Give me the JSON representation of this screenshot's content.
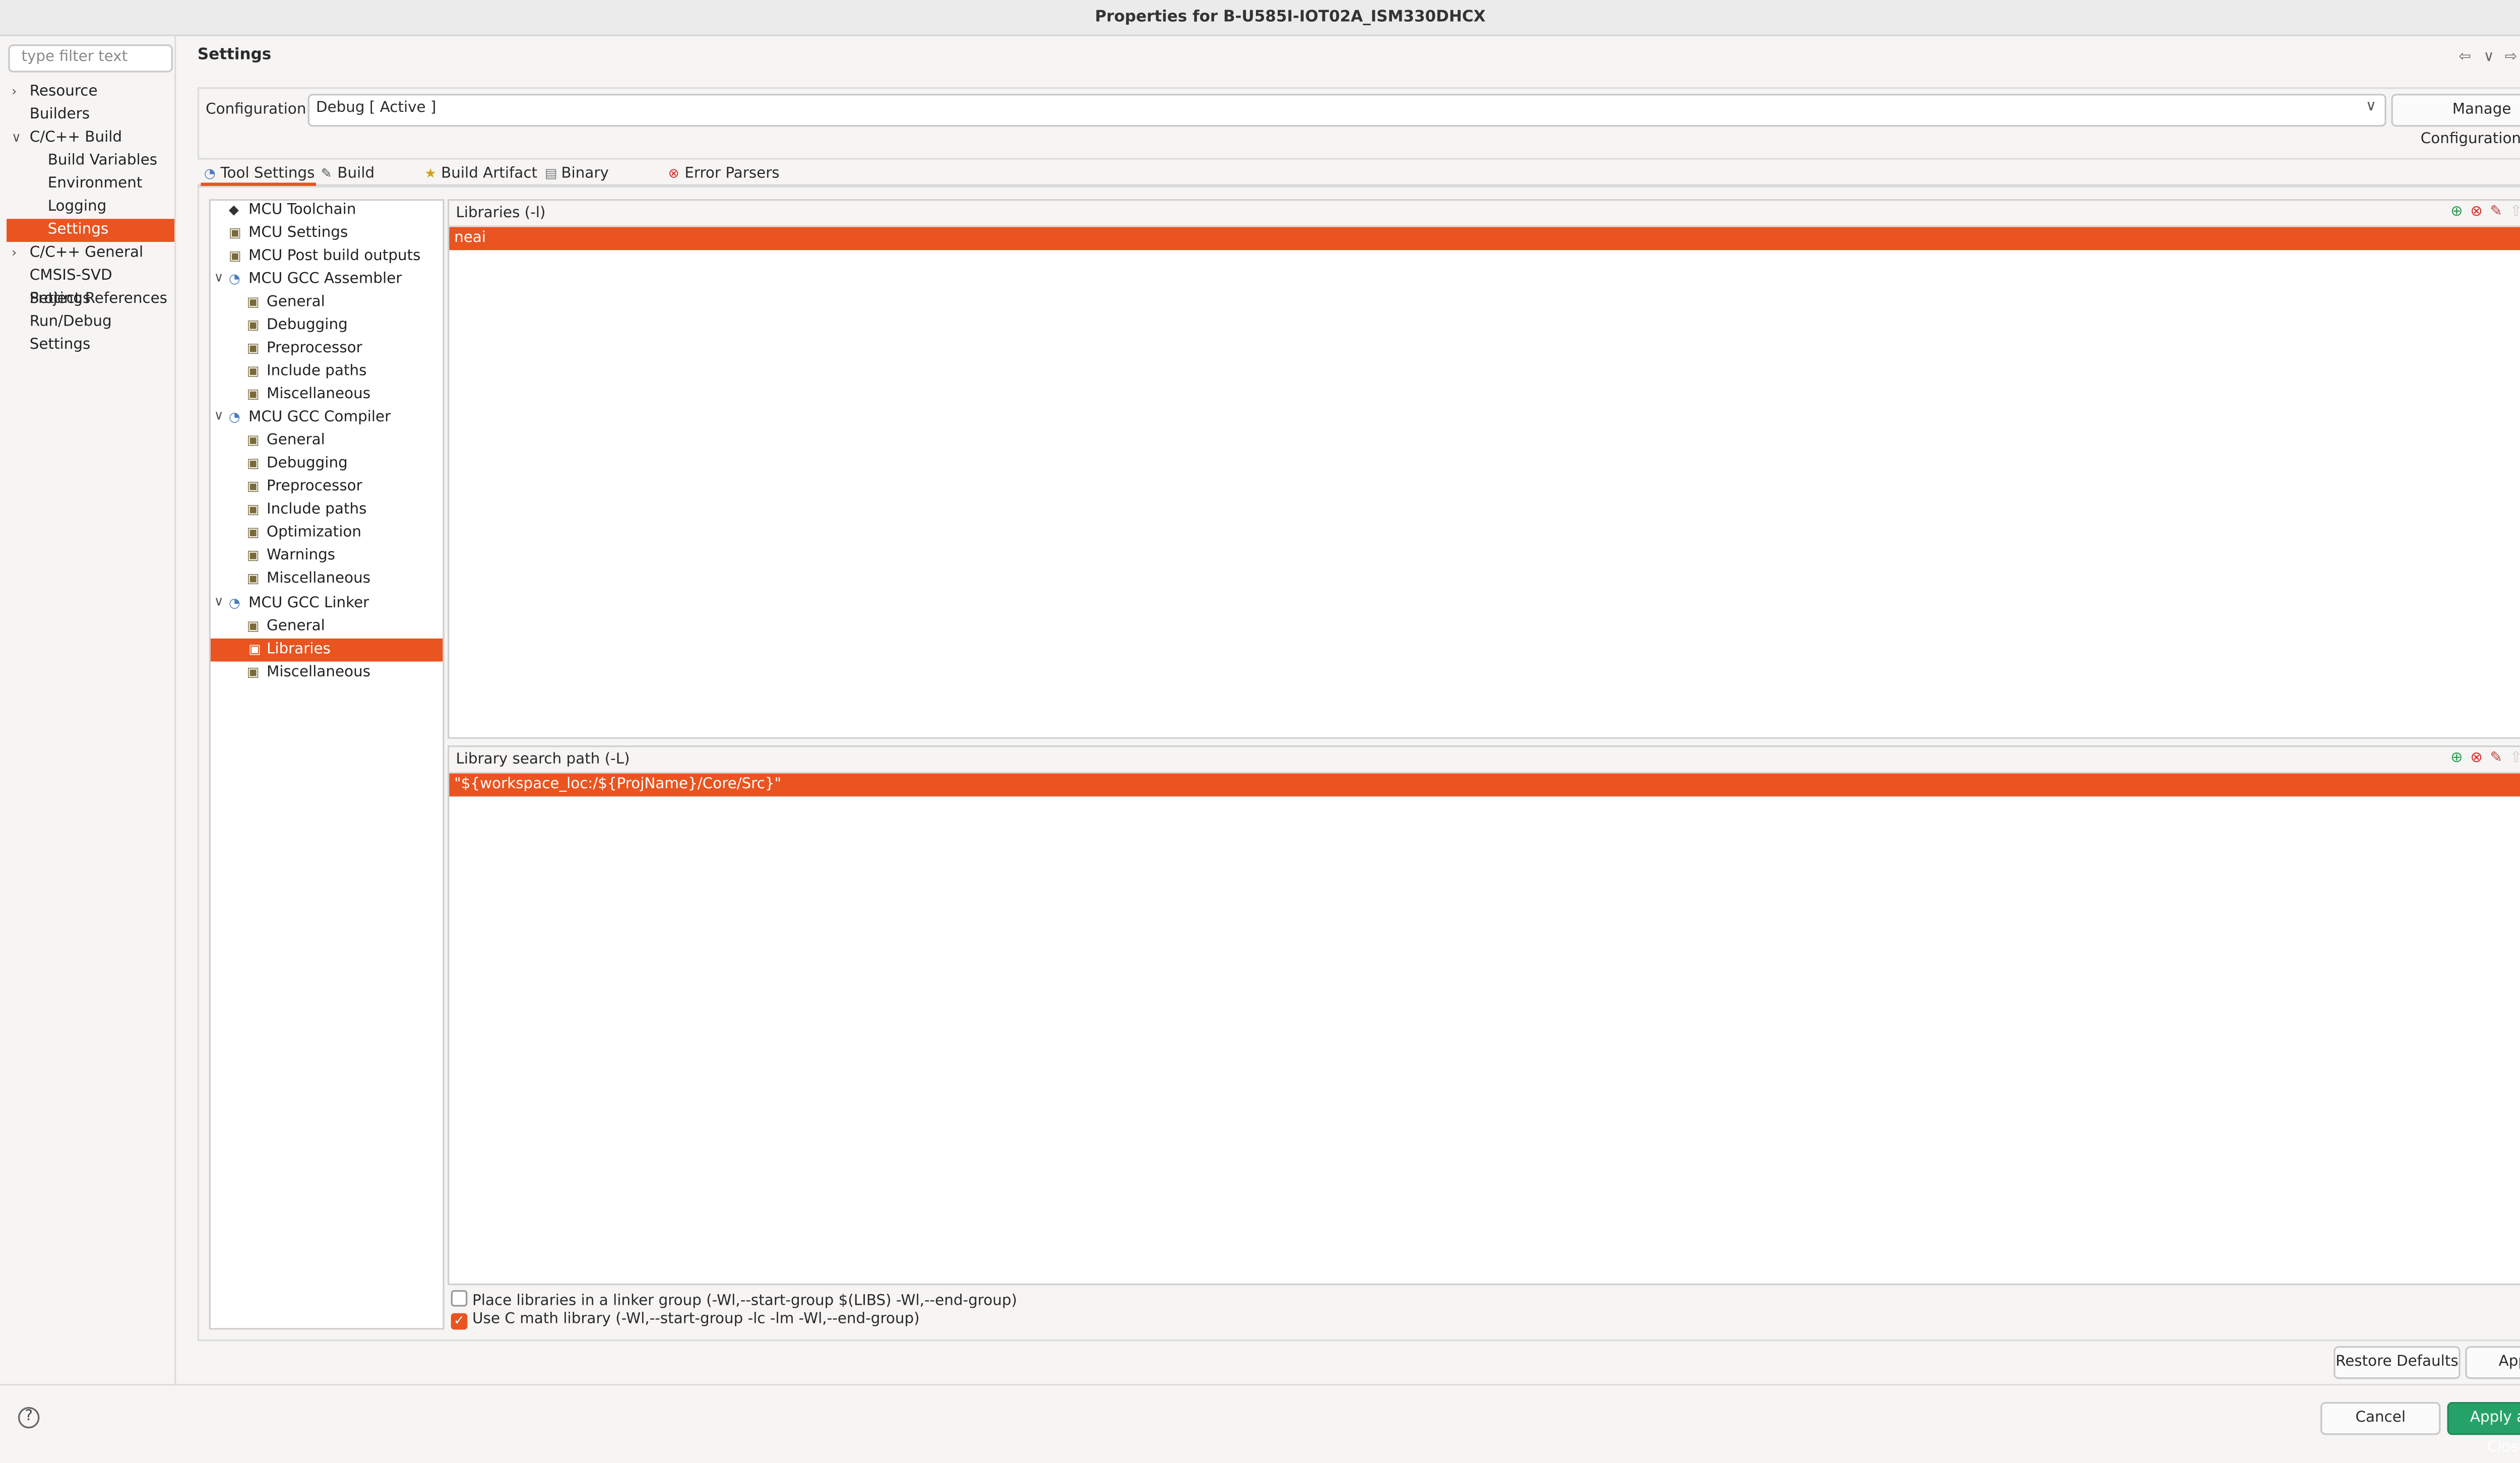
{
  "window": {
    "title": "Properties for B-U585I-IOT02A_ISM330DHCX"
  },
  "filter": {
    "placeholder": "type filter text"
  },
  "nav": {
    "items": [
      {
        "label": "Resource"
      },
      {
        "label": "Builders"
      },
      {
        "label": "C/C++ Build"
      },
      {
        "label": "Build Variables"
      },
      {
        "label": "Environment"
      },
      {
        "label": "Logging"
      },
      {
        "label": "Settings"
      },
      {
        "label": "C/C++ General"
      },
      {
        "label": "CMSIS-SVD Settings"
      },
      {
        "label": "Project References"
      },
      {
        "label": "Run/Debug Settings"
      }
    ],
    "selected": "Settings"
  },
  "page": {
    "title": "Settings"
  },
  "configuration": {
    "label": "Configuration:",
    "value": "Debug  [ Active ]",
    "manage_label": "Manage Configurations..."
  },
  "tabs": [
    {
      "label": "Tool Settings",
      "icon": "tool-settings-icon"
    },
    {
      "label": "Build Steps",
      "icon": "build-steps-icon"
    },
    {
      "label": "Build Artifact",
      "icon": "build-artifact-icon"
    },
    {
      "label": "Binary Parsers",
      "icon": "binary-parsers-icon"
    },
    {
      "label": "Error Parsers",
      "icon": "error-parsers-icon"
    }
  ],
  "tool_tree": [
    {
      "label": "MCU Toolchain"
    },
    {
      "label": "MCU Settings"
    },
    {
      "label": "MCU Post build outputs"
    },
    {
      "label": "MCU GCC Assembler"
    },
    {
      "label": "General"
    },
    {
      "label": "Debugging"
    },
    {
      "label": "Preprocessor"
    },
    {
      "label": "Include paths"
    },
    {
      "label": "Miscellaneous"
    },
    {
      "label": "MCU GCC Compiler"
    },
    {
      "label": "General"
    },
    {
      "label": "Debugging"
    },
    {
      "label": "Preprocessor"
    },
    {
      "label": "Include paths"
    },
    {
      "label": "Optimization"
    },
    {
      "label": "Warnings"
    },
    {
      "label": "Miscellaneous"
    },
    {
      "label": "MCU GCC Linker"
    },
    {
      "label": "General"
    },
    {
      "label": "Libraries"
    },
    {
      "label": "Miscellaneous"
    }
  ],
  "libraries": {
    "header": "Libraries (-l)",
    "items": [
      "neai"
    ]
  },
  "search_path": {
    "header": "Library search path (-L)",
    "items": [
      "\"${workspace_loc:/${ProjName}/Core/Src}\""
    ]
  },
  "options": {
    "linker_group": {
      "label": "Place libraries in a linker group (-Wl,--start-group $(LIBS) -Wl,--end-group)",
      "checked": false
    },
    "c_math": {
      "label": "Use C math library (-Wl,--start-group -lc -lm -Wl,--end-group)",
      "checked": true
    }
  },
  "buttons": {
    "restore_defaults": "Restore Defaults",
    "apply": "Apply",
    "cancel": "Cancel",
    "apply_close": "Apply and Close"
  },
  "colors": {
    "accent": "#e95420",
    "primary": "#26a269"
  }
}
